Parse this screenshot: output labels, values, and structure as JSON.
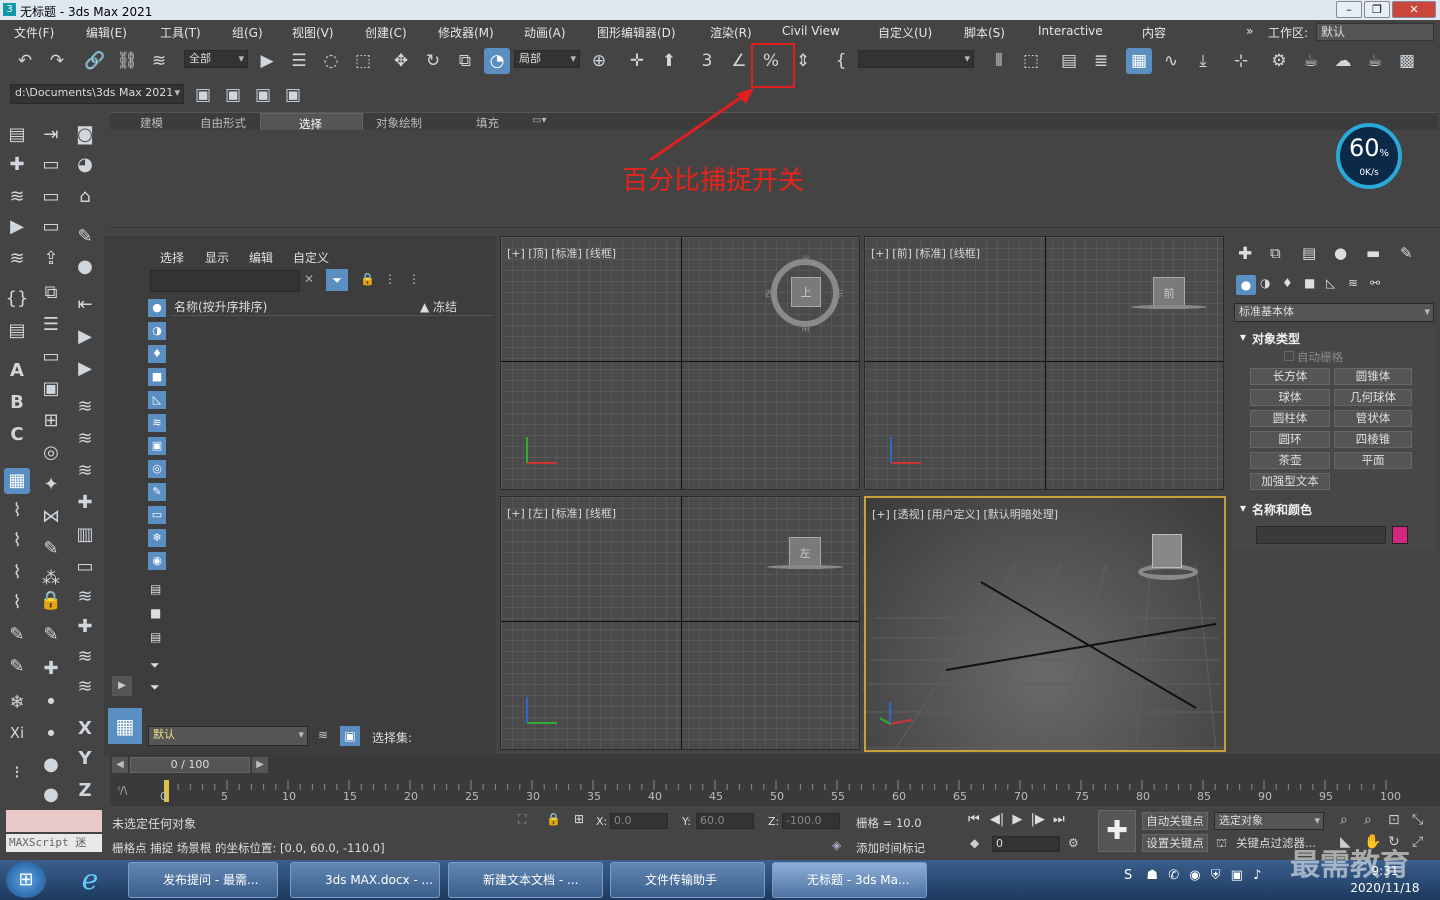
{
  "window": {
    "title": "无标题 - 3ds Max 2021",
    "app_icon": "3"
  },
  "menu": [
    "文件(F)",
    "编辑(E)",
    "工具(T)",
    "组(G)",
    "视图(V)",
    "创建(C)",
    "修改器(M)",
    "动画(A)",
    "图形编辑器(D)",
    "渲染(R)",
    "Civil View",
    "自定义(U)",
    "脚本(S)",
    "Interactive",
    "内容"
  ],
  "workspace": {
    "label": "工作区:",
    "value": "默认"
  },
  "toolbar": {
    "selection_filter": "全部",
    "coord_system": "局部",
    "path": "d:\\Documents\\3ds Max 2021"
  },
  "ribbon": {
    "tabs": [
      "建模",
      "自由形式",
      "选择",
      "对象绘制",
      "填充"
    ],
    "active_tab": "选择"
  },
  "annotation": {
    "text": "百分比捕捉开关",
    "color": "#e8231a"
  },
  "gauge": {
    "percent": "60",
    "unit": "%",
    "speed": "0K/s"
  },
  "scene_explorer": {
    "menu": [
      "选择",
      "显示",
      "编辑",
      "自定义"
    ],
    "column_name": "名称(按升序排序)",
    "column_freeze": "▲ 冻结",
    "layer": "默认",
    "selection_set_label": "选择集:"
  },
  "viewports": {
    "top": "[+] [顶] [标准] [线框]",
    "front": "[+] [前] [标准] [线框]",
    "left": "[+] [左] [标准] [线框]",
    "persp": "[+] [透视] [用户定义] [默认明暗处理]",
    "viewcube_top": {
      "n": "北",
      "s": "南",
      "w": "西",
      "e": "东",
      "face": "上"
    },
    "viewcube_front": "前",
    "viewcube_left": "左"
  },
  "command_panel": {
    "category": "标准基本体",
    "object_type_title": "对象类型",
    "autogrid": "自动栅格",
    "buttons": [
      "长方体",
      "圆锥体",
      "球体",
      "几何球体",
      "圆柱体",
      "管状体",
      "圆环",
      "四棱锥",
      "茶壶",
      "平面",
      "加强型文本"
    ],
    "name_color_title": "名称和颜色",
    "color_swatch": "#d22880"
  },
  "timeline": {
    "frame": "0 / 100",
    "ticks": [
      "0",
      "5",
      "10",
      "15",
      "20",
      "25",
      "30",
      "35",
      "40",
      "45",
      "50",
      "55",
      "60",
      "65",
      "70",
      "75",
      "80",
      "85",
      "90",
      "95",
      "100"
    ]
  },
  "status": {
    "maxscript": "MAXScript 迷",
    "msg1": "未选定任何对象",
    "msg2": "栅格点 捕捉 场景根 的坐标位置: [0.0, 60.0, -110.0]",
    "x_label": "X:",
    "x": "0.0",
    "y_label": "Y:",
    "y": "60.0",
    "z_label": "Z:",
    "z": "-100.0",
    "grid": "栅格 = 10.0",
    "add_time_tag": "添加时间标记",
    "auto_key": "自动关键点",
    "set_key": "设置关键点",
    "selected_object": "选定对象",
    "key_filter": "关键点过滤器...",
    "frame_field": "0"
  },
  "taskbar": {
    "items": [
      "发布提问 - 最需...",
      "3ds MAX.docx - ...",
      "新建文本文档 - ...",
      "文件传输助手",
      "无标题 - 3ds Ma..."
    ],
    "time": "9:31",
    "date": "2020/11/18",
    "watermark": "最需教育"
  }
}
